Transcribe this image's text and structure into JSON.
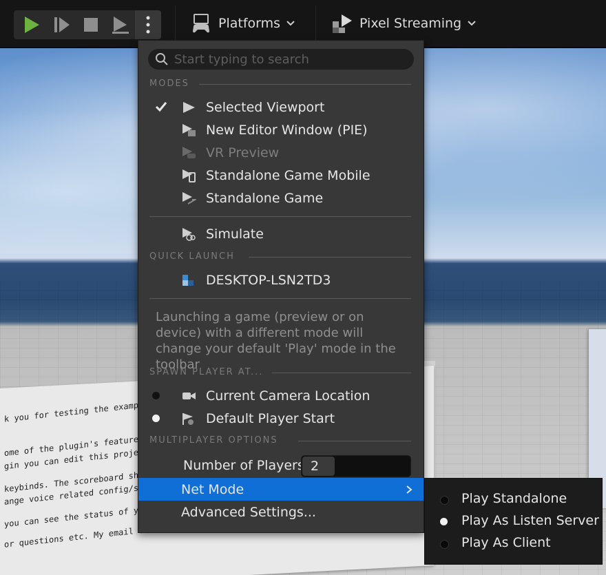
{
  "toolbar": {
    "play_icon": "play-icon",
    "colors": {
      "play": "#6db33f",
      "icon": "#9a9a9a"
    },
    "platforms_label": "Platforms",
    "pixel_streaming_label": "Pixel Streaming"
  },
  "menu": {
    "search_placeholder": "Start typing to search",
    "sections": {
      "modes": "MODES",
      "quick_launch": "QUICK LAUNCH",
      "spawn": "SPAWN PLAYER AT...",
      "multiplayer": "MULTIPLAYER OPTIONS"
    },
    "modes": [
      {
        "label": "Selected Viewport",
        "checked": true,
        "icon": "viewport-play-icon",
        "enabled": true
      },
      {
        "label": "New Editor Window (PIE)",
        "checked": false,
        "icon": "editor-window-icon",
        "enabled": true
      },
      {
        "label": "VR Preview",
        "checked": false,
        "icon": "vr-icon",
        "enabled": false
      },
      {
        "label": "Standalone Game Mobile",
        "checked": false,
        "icon": "mobile-icon",
        "enabled": true
      },
      {
        "label": "Standalone Game",
        "checked": false,
        "icon": "standalone-icon",
        "enabled": true
      }
    ],
    "simulate": {
      "label": "Simulate",
      "icon": "simulate-icon"
    },
    "quick_launch_device": "DESKTOP-LSN2TD3",
    "note": "Launching a game (preview or on device) with a different mode will change your default 'Play' mode in the toolbar",
    "spawn": [
      {
        "label": "Current Camera Location",
        "selected": false
      },
      {
        "label": "Default Player Start",
        "selected": true
      }
    ],
    "number_of_players_label": "Number of Players",
    "number_of_players": "2",
    "net_mode_label": "Net Mode",
    "advanced_settings_label": "Advanced Settings...",
    "highlight_color": "#0f6fd6"
  },
  "submenu": {
    "items": [
      {
        "label": "Play Standalone",
        "selected": false
      },
      {
        "label": "Play As Listen Server",
        "selected": true
      },
      {
        "label": "Play As Client",
        "selected": false
      }
    ]
  },
  "viewport": {
    "sign_lines": [
      "k you for testing the example pr",
      "ome of the plugin's features.",
      "gin you can edit this project in Un",
      "keybinds. The scoreboard shows",
      "ange voice related config/setting",
      "you can see the status of your micr",
      "or questions etc. My email can be"
    ]
  }
}
